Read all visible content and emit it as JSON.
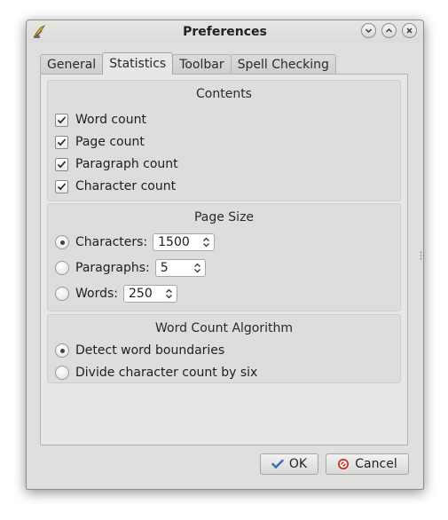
{
  "window": {
    "title": "Preferences",
    "icon": "quill-pen-icon"
  },
  "tabs": [
    {
      "label": "General",
      "active": false
    },
    {
      "label": "Statistics",
      "active": true
    },
    {
      "label": "Toolbar",
      "active": false
    },
    {
      "label": "Spell Checking",
      "active": false
    }
  ],
  "contents": {
    "title": "Contents",
    "items": [
      {
        "label": "Word count",
        "checked": true
      },
      {
        "label": "Page count",
        "checked": true
      },
      {
        "label": "Paragraph count",
        "checked": true
      },
      {
        "label": "Character count",
        "checked": true
      }
    ]
  },
  "page_size": {
    "title": "Page Size",
    "options": [
      {
        "label": "Characters:",
        "value": "1500",
        "selected": true
      },
      {
        "label": "Paragraphs:",
        "value": "5",
        "selected": false
      },
      {
        "label": "Words:",
        "value": "250",
        "selected": false
      }
    ]
  },
  "algorithm": {
    "title": "Word Count Algorithm",
    "options": [
      {
        "label": "Detect word boundaries",
        "selected": true
      },
      {
        "label": "Divide character count by six",
        "selected": false
      }
    ]
  },
  "buttons": {
    "ok": "OK",
    "cancel": "Cancel"
  },
  "colors": {
    "ok_check": "#3a6bb5",
    "cancel_icon": "#c0302a"
  }
}
